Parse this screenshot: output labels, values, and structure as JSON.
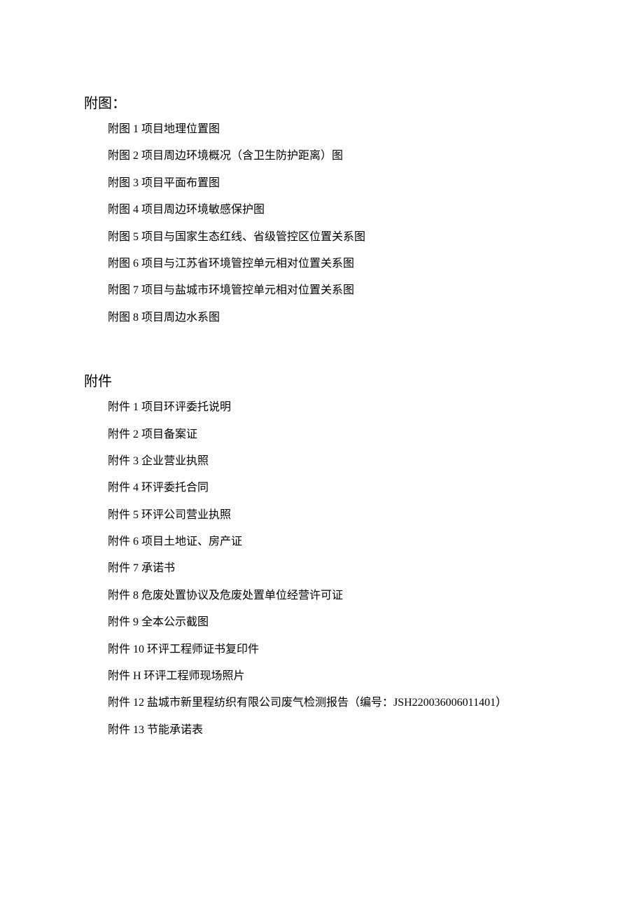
{
  "sections": {
    "figures": {
      "heading": "附图：",
      "items": [
        "附图 1 项目地理位置图",
        "附图 2 项目周边环境概况（含卫生防护距离）图",
        "附图 3 项目平面布置图",
        "附图 4 项目周边环境敏感保护图",
        "附图 5 项目与国家生态红线、省级管控区位置关系图",
        "附图 6 项目与江苏省环境管控单元相对位置关系图",
        "附图 7 项目与盐城市环境管控单元相对位置关系图",
        "附图 8 项目周边水系图"
      ]
    },
    "attachments": {
      "heading": "附件",
      "items": [
        "附件 1 项目环评委托说明",
        "附件 2 项目备案证",
        "附件 3 企业营业执照",
        "附件 4 环评委托合同",
        "附件 5 环评公司营业执照",
        "附件 6 项目土地证、房产证",
        "附件 7 承诺书",
        "附件 8 危废处置协议及危废处置单位经营许可证",
        "附件 9 全本公示截图",
        "附件 10 环评工程师证书复印件",
        "附件 H 环评工程师现场照片",
        "附件 12 盐城市新里程纺织有限公司废气检测报告（编号：JSH220036006011401）",
        "附件 13 节能承诺表"
      ]
    }
  }
}
